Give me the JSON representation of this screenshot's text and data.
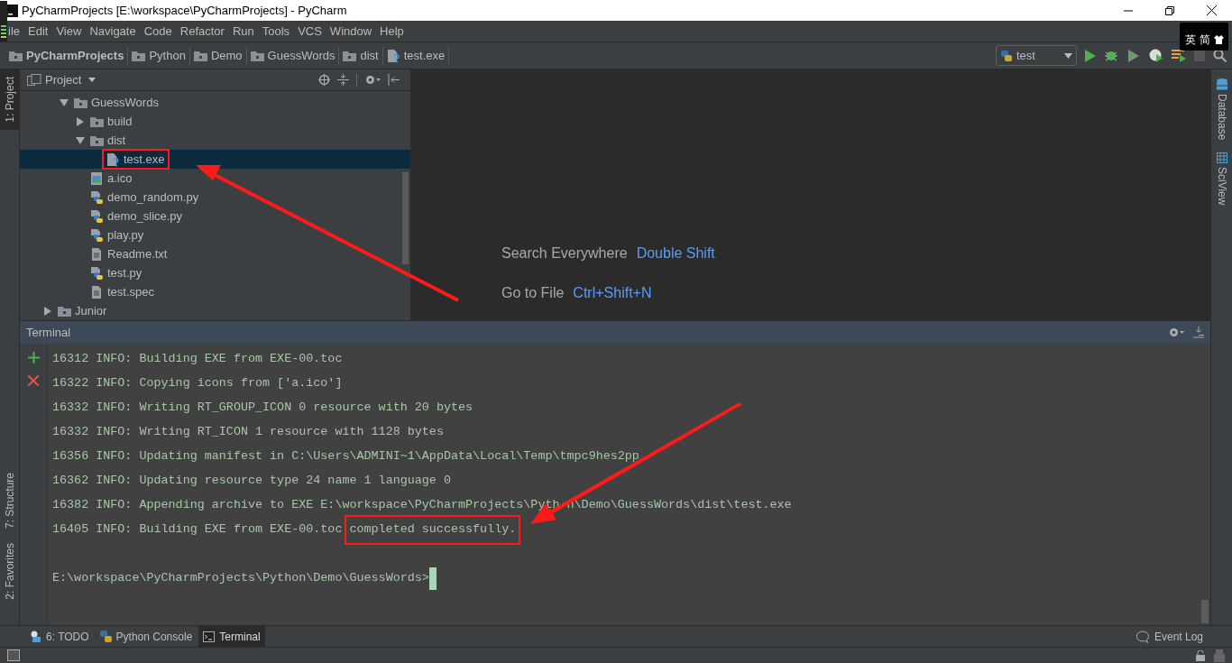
{
  "window": {
    "title": "PyCharmProjects [E:\\workspace\\PyCharmProjects] - PyCharm"
  },
  "menu": [
    "ile",
    "Edit",
    "View",
    "Navigate",
    "Code",
    "Refactor",
    "Run",
    "Tools",
    "VCS",
    "Window",
    "Help"
  ],
  "breadcrumbs": [
    {
      "label": "PyCharmProjects",
      "kind": "root"
    },
    {
      "label": "Python",
      "kind": "folder"
    },
    {
      "label": "Demo",
      "kind": "folder"
    },
    {
      "label": "GuessWords",
      "kind": "folder"
    },
    {
      "label": "dist",
      "kind": "folder"
    },
    {
      "label": "test.exe",
      "kind": "exe"
    }
  ],
  "run_config": {
    "label": "test"
  },
  "ime": {
    "keys": [
      "英",
      "简"
    ]
  },
  "left_tabs": [
    {
      "label": "1: Project",
      "selected": true
    },
    {
      "label": "7: Structure",
      "selected": false
    },
    {
      "label": "2: Favorites",
      "selected": false
    }
  ],
  "right_tabs": [
    {
      "label": "Database"
    },
    {
      "label": "SciView"
    }
  ],
  "project_panel": {
    "title": "Project",
    "tree": [
      {
        "children": [
          {
            "label": "GuessWords",
            "kind": "folder",
            "expanded": true,
            "selected": false,
            "children": [
              {
                "label": "build",
                "kind": "folder",
                "expanded": false,
                "selected": false
              },
              {
                "label": "dist",
                "kind": "folder",
                "expanded": true,
                "selected": false,
                "children": [
                  {
                    "label": "test.exe",
                    "kind": "exe",
                    "selected": true,
                    "boxed": true
                  }
                ]
              },
              {
                "label": "a.ico",
                "kind": "image",
                "selected": false
              },
              {
                "label": "demo_random.py",
                "kind": "python",
                "selected": false
              },
              {
                "label": "demo_slice.py",
                "kind": "python",
                "selected": false
              },
              {
                "label": "play.py",
                "kind": "python",
                "selected": false
              },
              {
                "label": "Readme.txt",
                "kind": "text",
                "selected": false
              },
              {
                "label": "test.py",
                "kind": "python",
                "selected": false
              },
              {
                "label": "test.spec",
                "kind": "text",
                "selected": false
              }
            ]
          }
        ]
      },
      {
        "label": "Junior",
        "kind": "folder",
        "expanded": false,
        "selected": false
      }
    ]
  },
  "editor_hints": [
    {
      "label": "Search Everywhere",
      "shortcut": "Double Shift"
    },
    {
      "label": "Go to File",
      "shortcut": "Ctrl+Shift+N"
    }
  ],
  "terminal": {
    "title": "Terminal",
    "lines": [
      {
        "text": "16312 INFO: Building EXE from EXE-00.toc"
      },
      {
        "text": "16322 INFO: Copying icons from ['a.ico']"
      },
      {
        "text": "16332 INFO: Writing RT_GROUP_ICON 0 resource with 20 bytes"
      },
      {
        "text": "16332 INFO: Writing RT_ICON 1 resource with 1128 bytes"
      },
      {
        "text": "16356 INFO: Updating manifest in C:\\Users\\ADMINI~1\\AppData\\Local\\Temp\\tmpc9hes2pp"
      },
      {
        "text": "16362 INFO: Updating resource type 24 name 1 language 0"
      },
      {
        "text": "16382 INFO: Appending archive to EXE E:\\workspace\\PyCharmProjects\\Pyth",
        "after_gap": "n\\Demo\\GuessWords\\dist\\test.exe"
      },
      {
        "text": "16405 INFO: Building EXE from EXE-00.toc",
        "boxed": "completed successfully."
      }
    ],
    "prompt": "E:\\workspace\\PyCharmProjects\\Python\\Demo\\GuessWords>"
  },
  "bottom_tabs": [
    {
      "label": "6: TODO",
      "kind": "todo",
      "selected": false
    },
    {
      "label": "Python Console",
      "kind": "python",
      "selected": false
    },
    {
      "label": "Terminal",
      "kind": "terminal",
      "selected": true
    }
  ],
  "event_log": {
    "label": "Event Log"
  }
}
